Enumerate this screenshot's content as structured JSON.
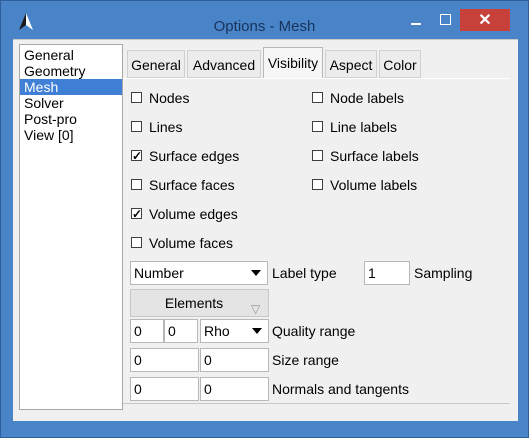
{
  "window": {
    "title": "Options - Mesh",
    "close_label": "✕",
    "accent": "#4a84c8",
    "close_color": "#c7413a"
  },
  "sidebar": {
    "items": [
      {
        "label": "General"
      },
      {
        "label": "Geometry"
      },
      {
        "label": "Mesh",
        "selected": true
      },
      {
        "label": "Solver"
      },
      {
        "label": "Post-pro"
      },
      {
        "label": "View [0]"
      }
    ],
    "selection_color": "#3f7fd6"
  },
  "tabs": [
    {
      "label": "General"
    },
    {
      "label": "Advanced"
    },
    {
      "label": "Visibility",
      "active": true
    },
    {
      "label": "Aspect"
    },
    {
      "label": "Color"
    }
  ],
  "visibility": {
    "checkboxes_left": [
      {
        "label": "Nodes",
        "checked": false
      },
      {
        "label": "Lines",
        "checked": false
      },
      {
        "label": "Surface edges",
        "checked": true
      },
      {
        "label": "Surface faces",
        "checked": false
      },
      {
        "label": "Volume edges",
        "checked": true
      },
      {
        "label": "Volume faces",
        "checked": false
      }
    ],
    "checkboxes_right": [
      {
        "label": "Node labels",
        "checked": false
      },
      {
        "label": "Line labels",
        "checked": false
      },
      {
        "label": "Surface labels",
        "checked": false
      },
      {
        "label": "Volume labels",
        "checked": false
      }
    ],
    "label_type": {
      "value": "Number",
      "label": "Label type"
    },
    "sampling": {
      "value": "1",
      "label": "Sampling"
    },
    "elements_button": "Elements",
    "quality": {
      "min": "0",
      "max": "0",
      "measure": "Rho",
      "label": "Quality range"
    },
    "size": {
      "min": "0",
      "max": "0",
      "label": "Size range"
    },
    "normals": {
      "normals": "0",
      "tangents": "0",
      "label": "Normals and tangents"
    }
  }
}
